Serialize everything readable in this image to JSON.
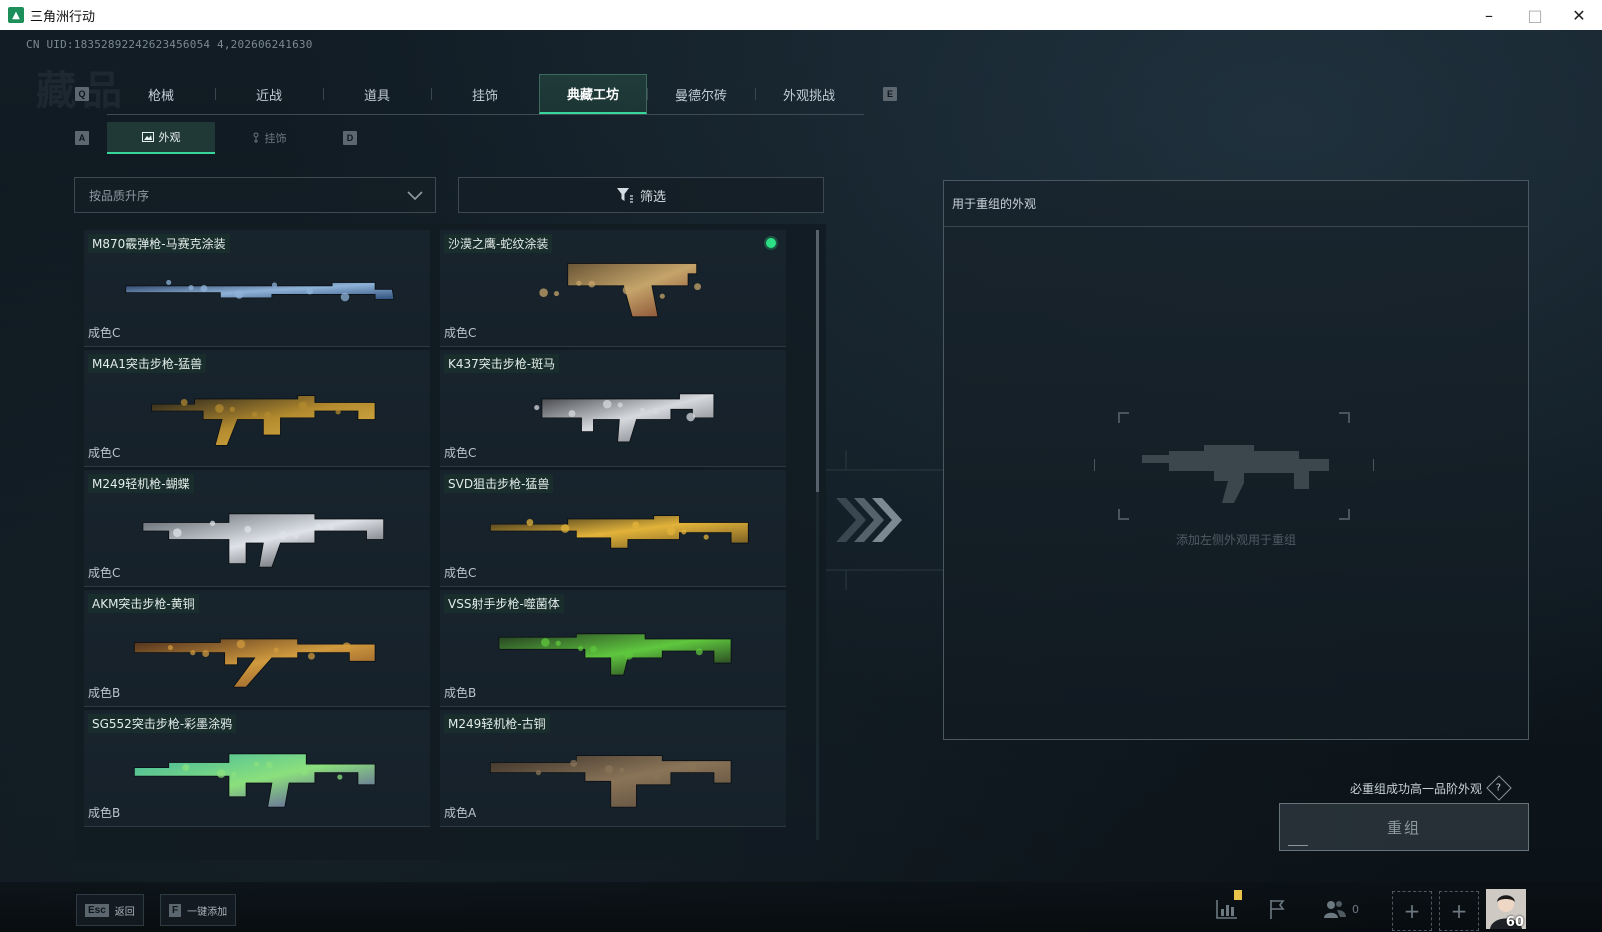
{
  "window": {
    "title": "三角洲行动",
    "minimize_icon": "minimize-icon",
    "maximize_icon": "maximize-icon",
    "close_icon": "close-icon"
  },
  "uid_text": "CN UID:18352892242623456054 4,202606241630",
  "background_watermark": "藏品",
  "tabs": {
    "left_key": "Q",
    "right_key": "E",
    "items": [
      {
        "label": "枪械",
        "active": false
      },
      {
        "label": "近战",
        "active": false
      },
      {
        "label": "道具",
        "active": false
      },
      {
        "label": "挂饰",
        "active": false
      },
      {
        "label": "典藏工坊",
        "active": true
      },
      {
        "label": "曼德尔砖",
        "active": false
      },
      {
        "label": "外观挑战",
        "active": false
      }
    ]
  },
  "subtabs": {
    "left_key": "A",
    "right_key": "D",
    "items": [
      {
        "label": "外观",
        "icon": "image-icon",
        "active": true
      },
      {
        "label": "挂饰",
        "icon": "charm-icon",
        "active": false
      }
    ]
  },
  "sort": {
    "label": "按品质升序",
    "icon": "chevron-down-icon"
  },
  "filter": {
    "label": "筛选",
    "icon": "filter-icon"
  },
  "items": [
    {
      "name": "M870霰弹枪-马赛克涂装",
      "grade": "成色C",
      "selected": false,
      "colors": [
        "#1b2f52",
        "#8fb3d8",
        "#2e4e7a"
      ]
    },
    {
      "name": "沙漠之鹰-蛇纹涂装",
      "grade": "成色C",
      "selected": true,
      "colors": [
        "#6a5636",
        "#c5a46a",
        "#7a3a26"
      ]
    },
    {
      "name": "M4A1突击步枪-猛兽",
      "grade": "成色C",
      "selected": false,
      "colors": [
        "#1e1e1c",
        "#b38a2e",
        "#e0b84a"
      ]
    },
    {
      "name": "K437突击步枪-斑马",
      "grade": "成色C",
      "selected": false,
      "colors": [
        "#3a3c40",
        "#d6d9dd",
        "#5d6066"
      ]
    },
    {
      "name": "M249轻机枪-蝴蝶",
      "grade": "成色C",
      "selected": false,
      "colors": [
        "#5a6068",
        "#dfe3e8",
        "#2b2f34"
      ]
    },
    {
      "name": "SVD狙击步枪-猛兽",
      "grade": "成色C",
      "selected": false,
      "colors": [
        "#2a2418",
        "#e2b33a",
        "#6b5320"
      ]
    },
    {
      "name": "AKM突击步枪-黄铜",
      "grade": "成色B",
      "selected": false,
      "colors": [
        "#4a2c1c",
        "#d09a3e",
        "#7b4424"
      ]
    },
    {
      "name": "VSS射手步枪-噬菌体",
      "grade": "成色B",
      "selected": false,
      "colors": [
        "#243a22",
        "#5fc73e",
        "#1a1f1a"
      ]
    },
    {
      "name": "SG552突击步枪-彩墨涂鸦",
      "grade": "成色B",
      "selected": false,
      "colors": [
        "#3fb6a0",
        "#8be07c",
        "#5a3ea8"
      ]
    },
    {
      "name": "M249轻机枪-古铜",
      "grade": "成色A",
      "selected": false,
      "colors": [
        "#3a3128",
        "#8a7458",
        "#57483a"
      ]
    }
  ],
  "panel": {
    "title": "用于重组的外观",
    "hint": "添加左侧外观用于重组",
    "placeholder_icon": "rifle-silhouette-icon"
  },
  "arrows_icon": "triple-chevron-right-icon",
  "guarantee": {
    "text": "必重组成功高一品阶外观",
    "help_glyph": "?"
  },
  "regroup_button": "重组",
  "bottom": {
    "esc_key": "Esc",
    "esc_label": "返回",
    "f_key": "F",
    "f_label": "一键添加",
    "friends_count": "0",
    "player_level": "60"
  }
}
